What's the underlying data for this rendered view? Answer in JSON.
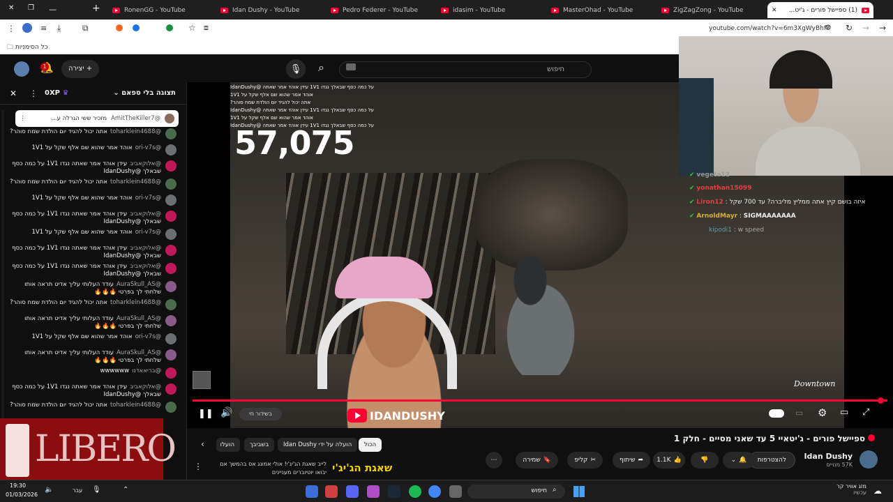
{
  "browser": {
    "tabs": [
      {
        "title": "RonenGG - YouTube"
      },
      {
        "title": "Idan Dushy - YouTube"
      },
      {
        "title": "Pedro Federer - YouTube"
      },
      {
        "title": "idasim - YouTube"
      },
      {
        "title": "MasterOhad - YouTube"
      },
      {
        "title": "ZigZagZong - YouTube"
      },
      {
        "title": "(1) ספיישל פורים - ג'יט..."
      }
    ],
    "url": "youtube.com/watch?v=6m3XgWyBhfY",
    "bookmarks_label": "כל הסימניות"
  },
  "yt_header": {
    "search_placeholder": "חיפוש",
    "create_label": "יצירה",
    "notif_count": "1"
  },
  "chat": {
    "header_label": "תצוגה בלי ספאם",
    "xp_label": "0XP",
    "pinned": {
      "author": "@AmitTheKiller7",
      "text": "מזכיר ששי הגרלה ע..."
    },
    "messages": [
      {
        "author": "@toharklein4688",
        "text": "אתה יכול להגיד יום הולדת שמח סוהר?"
      },
      {
        "author": "@ori-v7s",
        "text": "אוהד אמר שהוא שם אלף שקל על 1V1"
      },
      {
        "author": "@אלוקאביב",
        "text": "עידן אוהד אמר שאתה נגדו 1V1 על כמה כסף שבאלך @IdanDushy"
      },
      {
        "author": "@toharklein4688",
        "text": "אתה יכול להגיד יום הולדת שמח סוהר?"
      },
      {
        "author": "@ori-v7s",
        "text": "אוהד אמר שהוא שם אלף שקל על 1V1"
      },
      {
        "author": "@אלוקאביב",
        "text": "עידן אוהד אמר שאתה נגדו 1V1 על כמה כסף שבאלך @IdanDushy"
      },
      {
        "author": "@ori-v7s",
        "text": "אוהד אמר שהוא שם אלף שקל על 1V1"
      },
      {
        "author": "@אלוקאביב",
        "text": "עידן אוהד אמר שאתה נגדו 1V1 על כמה כסף שבאלך @IdanDushy"
      },
      {
        "author": "@אלוקאביב",
        "text": "עידן אוהד אמר שאתה נגדו 1V1 על כמה כסף שבאלך @IdanDushy"
      },
      {
        "author": "@AuraSkull_AS",
        "text": "עודד העלותי עליך אדיט תראה אותו שלחתי לך בפרטי 🔥🔥🔥"
      },
      {
        "author": "@toharklein4688",
        "text": "אתה יכול להגיד יום הולדת שמח סוהר?"
      },
      {
        "author": "@AuraSkull_AS",
        "text": "עודד העלותי עליך אדיט תראה אותו שלחתי לך בפרטי 🔥🔥🔥"
      },
      {
        "author": "@ori-v7s",
        "text": "אוהד אמר שהוא שם אלף שקל על 1V1"
      },
      {
        "author": "@AuraSkull_AS",
        "text": "עודד העלותי עליך אדיט תראה אותו שלחתי לך בפרטי 🔥🔥🔥"
      },
      {
        "author": "@בריאאדנו",
        "text": "wwwwww"
      },
      {
        "author": "@אלוקאביב",
        "text": "עידן אוהד אמר שאתה נגדו 1V1 על כמה כסף שבאלך @IdanDushy"
      },
      {
        "author": "@toharklein4688",
        "text": "אתה יכול להגיד יום הולדת שמח סוהר?"
      }
    ]
  },
  "video": {
    "counter": "57,075",
    "location_label": "Downtown",
    "live_label": "בשידור חי",
    "brand": "IDANDUSHY",
    "overlay_chat": [
      "על כמה כסף שבאלך נגדו 1V1 עידן אוהד אמר שאתה @IdanDushy",
      "אוהד אמר שהוא שם אלף שקל על 1V1",
      "אתה יכול להגיד יום הולדת שמח סוהר?",
      "על כמה כסף שבאלך נגדו 1V1 עידן אוהד אמר שאתה @IdanDushy",
      "אוהד אמר שהוא שם אלף שקל על 1V1",
      "על כמה כסף שבאלך נגדו 1V1 עידן אוהד אמר שאתה @IdanDushy"
    ],
    "twitch_chat": [
      {
        "user": "vegeta12",
        "text": ""
      },
      {
        "user": "yonathan15099",
        "text": ""
      },
      {
        "user": "Liron12",
        "text": "איזה בושם קיץ אתה ממליץ מליברה? עד 700 שקל"
      },
      {
        "user": "ArnoldMayr",
        "text": "SIGMAAAAAAA"
      },
      {
        "user": "kipodi1",
        "text": "w speed"
      }
    ]
  },
  "below": {
    "title": "ספיישל פורים - ג'יטאיי 5 עד שאני מסיים - חלק 1",
    "channel": "Idan Dushy",
    "subs": "57K מנויים",
    "subscribe": "להצטרפות",
    "likes": "1.1K",
    "share": "שיתוף",
    "clip": "קליפ",
    "save": "שמירה",
    "chips": [
      "הכול",
      "הועלה על ידי Idan Dushy",
      "בשביבך",
      "הועלו"
    ],
    "rec_title": "שאגת הג'יג'י",
    "rec_desc": "לייב שאגת הג'יג'י! אולי אמונג אס בהמשך אם יבואו יוטיוברים מעניינים"
  },
  "ad": {
    "brand": "LIBERO"
  },
  "taskbar": {
    "time": "19:30",
    "date": "01/03/2026",
    "lang": "עבר",
    "search": "חיפוש",
    "weather": "מזג אוויר קר",
    "weather_sub": "עכשיו"
  },
  "colors": {
    "accent": "#ff0033",
    "bg": "#0f0f0f",
    "chip": "#272727"
  }
}
